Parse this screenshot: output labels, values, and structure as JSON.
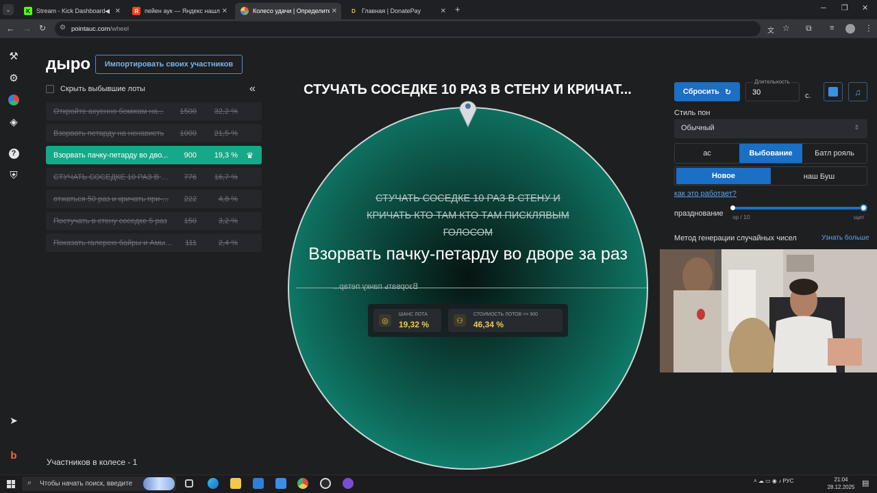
{
  "browser": {
    "tabs": [
      {
        "title": "Stream - Kick Dashboard",
        "icon": "kick-icon"
      },
      {
        "title": "пейен аук — Яндекс нашлось",
        "icon": "yandex-icon"
      },
      {
        "title": "Колесо удачи | Определите п",
        "icon": "pointauc-icon"
      },
      {
        "title": "Главная | DonatePay",
        "icon": "donatepay-icon"
      }
    ],
    "active_tab": 2,
    "url_host": "pointauc.com",
    "url_path": "/wheel"
  },
  "panel": {
    "title": "дыро",
    "import_button": "Импортировать своих участников",
    "hide_dropped": "Скрыть выбывшие лоты",
    "collapse_icon": "«",
    "lots": [
      {
        "name": "Откройте ахуенно бомжам на...",
        "amount": "1500",
        "percent": "32,2 %",
        "out": true
      },
      {
        "name": "Взорвать петарду на ненависть",
        "amount": "1000",
        "percent": "21,5 %",
        "out": true
      },
      {
        "name": "Взорвать пачку-петарду во дво...",
        "amount": "900",
        "percent": "19,3 %",
        "out": false
      },
      {
        "name": "СТУЧАТЬ СОСЕДКЕ 10 РАЗ В СТ...",
        "amount": "776",
        "percent": "16,7 %",
        "out": true
      },
      {
        "name": "отжаться 50 раз и кричать при-...",
        "amount": "222",
        "percent": "4,8 %",
        "out": true
      },
      {
        "name": "Постучать в стену соседке 5 раз",
        "amount": "150",
        "percent": "3,2 %",
        "out": true
      },
      {
        "name": "Показать галерею байры и Амы-...",
        "amount": "111",
        "percent": "2,4 %",
        "out": true
      }
    ],
    "participants": "Участников в колесе - 1"
  },
  "wheel": {
    "headline": "СТУЧАТЬ СОСЕДКЕ 10 РАЗ В СТЕНУ И КРИЧАТ...",
    "struck_text": "СТУЧАТЬ СОСЕДКЕ 10 РАЗ В СТЕНУ И КРИЧАТЬ КТО ТАМ КТО ТАМ ПИСКЛЯВЫМ ГОЛОСОМ",
    "winner_text": "Взорвать пачку-петарду во дворе за раз",
    "mirrored_text": "Взорвать пачку петар...",
    "stat1_label": "ШАНС ЛОТА",
    "stat1_value": "19,32 %",
    "stat2_label": "СТОИМОСТЬ ЛОТОВ <= 900",
    "stat2_value": "46,34 %"
  },
  "settings": {
    "reset_button": "Сбросить",
    "duration_label": "Длительность",
    "duration_value": "30",
    "duration_unit": "с.",
    "style_label": "Стиль пон",
    "style_value": "Обычный",
    "modes": [
      "ас",
      "Выбование",
      "Батл рояль"
    ],
    "active_mode": 1,
    "variants": [
      "Новое",
      "наш Буш"
    ],
    "active_variant": 0,
    "how_link": "как это работает?",
    "celebration_label": "празднование",
    "slider_min": "эр / 10",
    "slider_max": "щит",
    "slider_fraction": 1.0,
    "rng_label": "Метод генерации случайных чисел",
    "rng_more": "Узнать больше"
  },
  "taskbar": {
    "search_placeholder": "Чтобы начать поиск, введите",
    "lang": "РУС",
    "time": "21:04",
    "date": "28.12.2025"
  },
  "colors": {
    "accent": "#1b6fc4",
    "selected_lot": "#16a889",
    "wheel_green": "#13917d",
    "stat_value": "#f2c94c"
  }
}
